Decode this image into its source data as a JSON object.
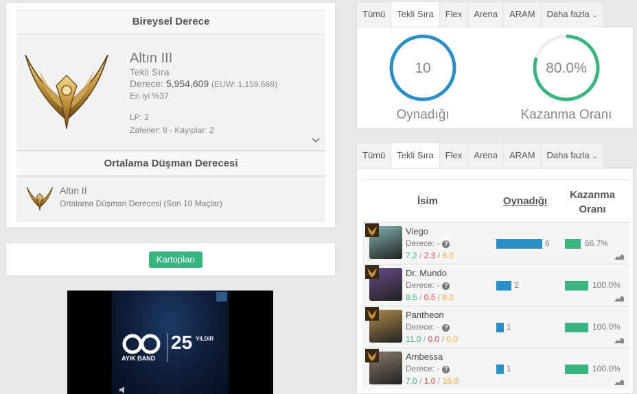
{
  "rank_panel": {
    "heading": "Bireysel Derece",
    "tier": "Altın III",
    "queue": "Tekli Sıra",
    "ladder_label": "Derece:",
    "ladder_value": "5,954,609",
    "ladder_region": "(EUW: 1,159,688)",
    "top_percent": "En iyi %37",
    "lp": "LP: 2",
    "record": "Zaferler: 8 - Kayıplar: 2",
    "enemy_heading": "Ortalama Düşman Derecesi",
    "enemy_tier": "Altın II",
    "enemy_desc": "Ortalama Düşman Derecesi (Son 10 Maçlar)"
  },
  "maps": {
    "button_label": "Kartopları"
  },
  "ad": {
    "brand": "AYIK BAND",
    "years": "25",
    "years_label": "YILDIR"
  },
  "tabs_top": [
    {
      "label": "Tümü"
    },
    {
      "label": "Tekli Sıra"
    },
    {
      "label": "Flex"
    },
    {
      "label": "Arena"
    },
    {
      "label": "ARAM"
    },
    {
      "label": "Daha fazla"
    }
  ],
  "stats": {
    "played_value": "10",
    "played_label": "Oynadığı",
    "winrate_value": "80.0%",
    "winrate_fraction": 0.8,
    "winrate_label": "Kazanma Oranı"
  },
  "tabs_bottom": [
    {
      "label": "Tümü"
    },
    {
      "label": "Tekli Sıra"
    },
    {
      "label": "Flex"
    },
    {
      "label": "Arena"
    },
    {
      "label": "ARAM"
    },
    {
      "label": "Daha fazla"
    }
  ],
  "champ_table": {
    "headers": {
      "name": "İsim",
      "played": "Oynadığı",
      "winrate_l1": "Kazanma",
      "winrate_l2": "Oranı"
    },
    "rows": [
      {
        "name": "Viego",
        "rank": "Derece: -",
        "k": "7.2",
        "d": "2.3",
        "a": "6.0",
        "played": "6",
        "played_n": 6,
        "winrate": "66.7%",
        "winrate_f": 0.667,
        "color": "#7fb3b0"
      },
      {
        "name": "Dr. Mundo",
        "rank": "Derece: -",
        "k": "8.5",
        "d": "0.5",
        "a": "8.0",
        "played": "2",
        "played_n": 2,
        "winrate": "100.0%",
        "winrate_f": 1.0,
        "color": "#6a4a8a"
      },
      {
        "name": "Pantheon",
        "rank": "Derece: -",
        "k": "11.0",
        "d": "0.0",
        "a": "0.0",
        "played": "1",
        "played_n": 1,
        "winrate": "100.0%",
        "winrate_f": 1.0,
        "color": "#b08a4a"
      },
      {
        "name": "Ambessa",
        "rank": "Derece: -",
        "k": "7.0",
        "d": "1.0",
        "a": "15.0",
        "played": "1",
        "played_n": 1,
        "winrate": "100.0%",
        "winrate_f": 1.0,
        "color": "#8a7a6a"
      }
    ]
  },
  "colors": {
    "accent_blue": "#2a8fc6",
    "accent_green": "#3bb57f",
    "kill": "#3bb57f",
    "death": "#e04545",
    "assist": "#f0a93c"
  }
}
